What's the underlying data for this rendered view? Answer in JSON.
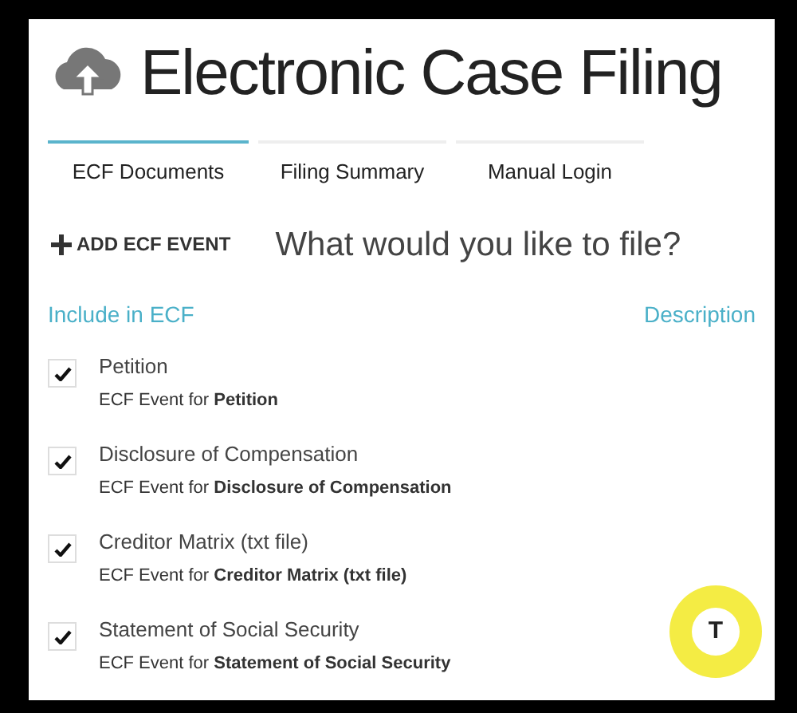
{
  "header": {
    "title": "Electronic Case Filing"
  },
  "tabs": [
    {
      "label": "ECF Documents",
      "selected": true
    },
    {
      "label": "Filing Summary",
      "selected": false
    },
    {
      "label": "Manual Login",
      "selected": false
    }
  ],
  "add_button": {
    "label": "ADD ECF EVENT"
  },
  "prompt": "What would you like to file?",
  "columns": [
    "Include in ECF",
    "Description"
  ],
  "events": [
    {
      "name": "Petition",
      "description": "ECF Event for **Petition**",
      "checked": true
    },
    {
      "name": "Disclosure of Compensation",
      "description": "ECF Event for **Disclosure of Compensation**",
      "checked": true
    },
    {
      "name": "Creditor Matrix (txt file)",
      "description": "ECF Event for **Creditor Matrix (txt file)**",
      "checked": true
    },
    {
      "name": "Statement of Social Security",
      "description": "ECF Event for **Statement of Social Security**",
      "checked": true
    }
  ],
  "floating_button": {
    "label": "T"
  }
}
